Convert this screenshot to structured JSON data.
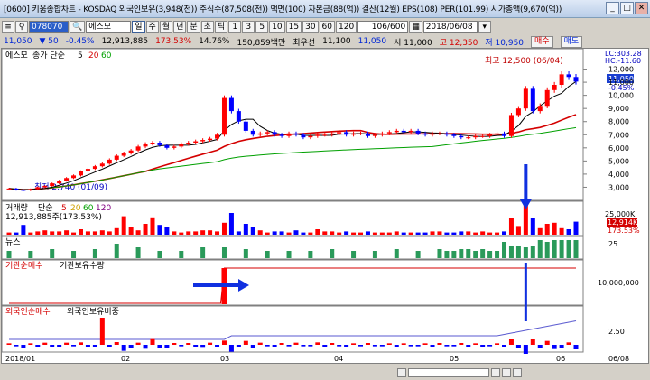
{
  "window": {
    "title": "[0600] 키움종합차트 - KOSDAQ 외국인보유(3,948(천)) 주식수(87,508(천)) 액면(100) 자본금(88(억)) 결산(12월) EPS(108) PER(101.99) 시가총액(9,670(억))",
    "buttons": [
      "_",
      "□",
      "✕"
    ]
  },
  "toolbar": {
    "code": "078070",
    "stock_name": "에스모",
    "periods": [
      "주",
      "월",
      "년",
      "분",
      "초",
      "틱"
    ],
    "minutes": [
      "1",
      "3",
      "5",
      "10",
      "15",
      "30",
      "60",
      "120"
    ],
    "count": "106/600",
    "date": "2018/06/08"
  },
  "info": {
    "price": "11,050",
    "change": "▼ 50",
    "change_pct": "-0.45%",
    "volume": "12,913,885",
    "vol_ratio": "173.53%",
    "turnover": "14.76%",
    "amount": "150,859백만",
    "recent": "최우선",
    "recent_val": "11,100",
    "recent2": "11,050",
    "open": "시 11,000",
    "high": "고 12,350",
    "low": "저 10,950",
    "buy": "매수",
    "sell": "매도"
  },
  "panels": {
    "price": {
      "legend_name": "에스모",
      "legend_ma": "종가 단순",
      "ma": [
        "5",
        "20",
        "60"
      ],
      "high_label": "최고 12,500 (06/04)",
      "low_label": "최저 2,740 (01/09)",
      "lc": "LC:303.28",
      "hc": "HC:-11.60",
      "last": "11,050",
      "last_pct": "-0.45%",
      "yticks": [
        "12,000",
        "11,000",
        "10,000",
        "9,000",
        "8,000",
        "7,000",
        "6,000",
        "5,000",
        "4,000",
        "3,000"
      ]
    },
    "volume": {
      "legend": "거래량",
      "legend_ma": "단순",
      "ma": [
        "5",
        "20",
        "60",
        "120"
      ],
      "value": "12,913,885주(173.53%)",
      "ytick": "25,000K",
      "last": "12,914K",
      "last_pct": "173.53%"
    },
    "news": {
      "legend": "뉴스",
      "ytick": "25"
    },
    "inst": {
      "legend1": "기관순매수",
      "legend2": "기관보유수량",
      "ytick": "10,000,000"
    },
    "foreign": {
      "legend1": "외국인순매수",
      "legend2": "외국인보유비중",
      "ytick": "2.50"
    }
  },
  "xaxis": [
    "2018/01",
    "02",
    "03",
    "04",
    "05",
    "06",
    "06/08"
  ],
  "colors": {
    "up": "#ff0000",
    "down": "#0000ff",
    "ma5": "#000000",
    "ma20": "#d40000",
    "ma60": "#00a000",
    "arrow": "#1030e0"
  },
  "chart_data": {
    "type": "candlestick",
    "close_series": [
      2900,
      2800,
      2760,
      2850,
      3000,
      3100,
      3300,
      3500,
      3700,
      3900,
      4200,
      4400,
      4600,
      4800,
      5100,
      5400,
      5600,
      5800,
      6100,
      6300,
      6400,
      6200,
      6000,
      6100,
      6300,
      6400,
      6500,
      6600,
      6700,
      7000,
      9800,
      8800,
      8000,
      7300,
      7000,
      7100,
      7200,
      7000,
      6900,
      7100,
      7000,
      6800,
      6900,
      7000,
      7000,
      7100,
      7200,
      7000,
      7100,
      7100,
      6900,
      7000,
      7100,
      7200,
      7300,
      7200,
      7300,
      7100,
      7000,
      7100,
      7100,
      7000,
      6900,
      6800,
      6800,
      6900,
      6900,
      7000,
      7100,
      6900,
      8500,
      9000,
      10500,
      8800,
      9200,
      10400,
      10800,
      11600,
      11400,
      11050
    ],
    "volume_series": [
      2,
      2,
      9,
      2,
      3,
      4,
      3,
      3,
      4,
      2,
      5,
      3,
      3,
      4,
      3,
      6,
      17,
      7,
      4,
      10,
      16,
      9,
      7,
      3,
      2,
      3,
      3,
      4,
      4,
      3,
      11,
      20,
      3,
      10,
      7,
      4,
      2,
      3,
      3,
      2,
      4,
      2,
      2,
      5,
      3,
      3,
      2,
      3,
      2,
      2,
      3,
      2,
      2,
      2,
      3,
      2,
      2,
      2,
      2,
      3,
      3,
      2,
      2,
      3,
      3,
      2,
      3,
      2,
      2,
      3,
      15,
      8,
      28,
      15,
      6,
      10,
      11,
      6,
      5,
      12
    ]
  }
}
